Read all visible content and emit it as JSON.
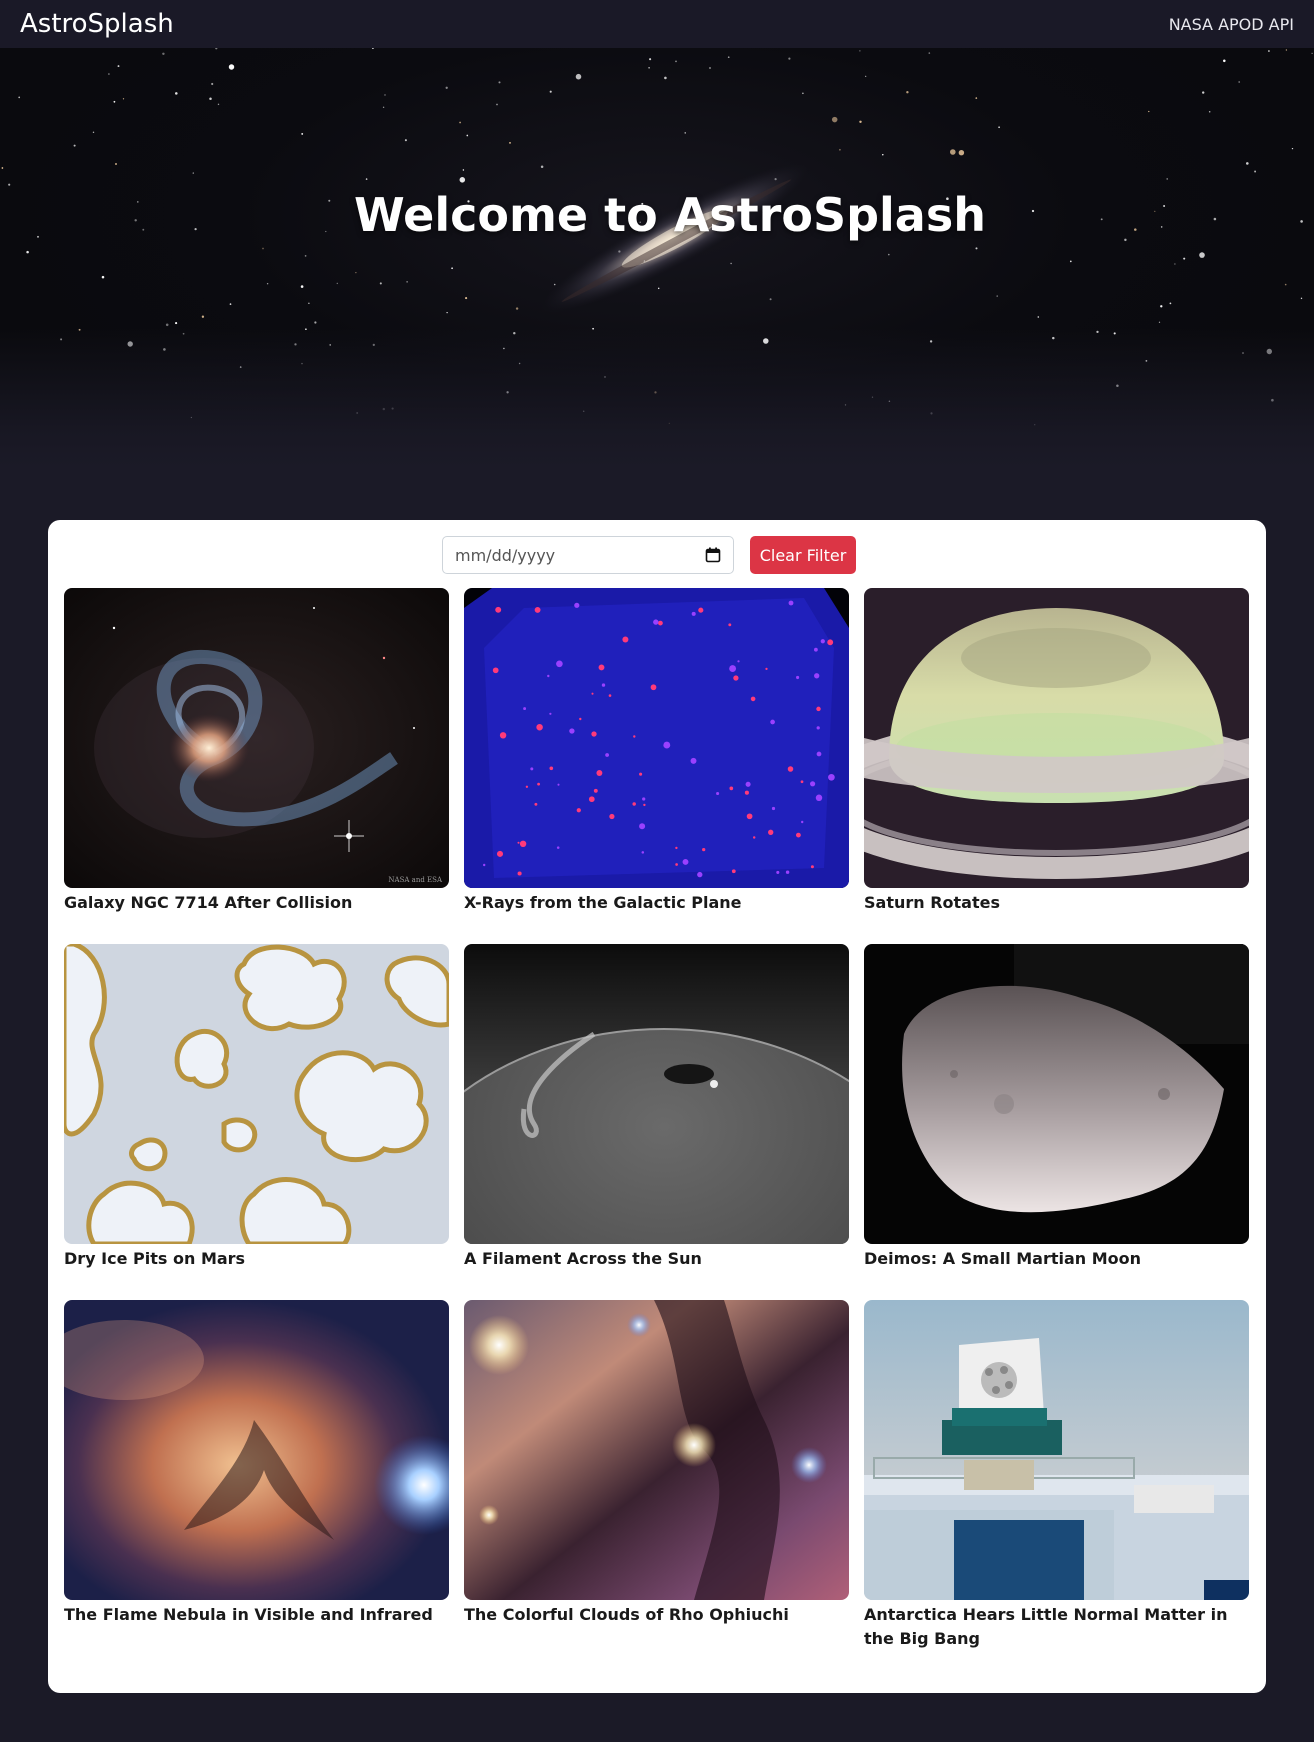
{
  "navbar": {
    "brand": "AstroSplash",
    "link": "NASA APOD API"
  },
  "hero": {
    "title": "Welcome to AstroSplash"
  },
  "filter": {
    "date_placeholder": "mm/dd/yyyy",
    "clear_label": "Clear Filter"
  },
  "gallery": [
    {
      "title": "Galaxy NGC 7714 After Collision",
      "credit": "NASA and ESA"
    },
    {
      "title": "X-Rays from the Galactic Plane"
    },
    {
      "title": "Saturn Rotates"
    },
    {
      "title": "Dry Ice Pits on Mars"
    },
    {
      "title": "A Filament Across the Sun"
    },
    {
      "title": "Deimos: A Small Martian Moon"
    },
    {
      "title": "The Flame Nebula in Visible and Infrared"
    },
    {
      "title": "The Colorful Clouds of Rho Ophiuchi"
    },
    {
      "title": "Antarctica Hears Little Normal Matter in the Big Bang"
    }
  ],
  "colors": {
    "page_bg": "#1b1a27",
    "clear_button": "#dc3545"
  }
}
